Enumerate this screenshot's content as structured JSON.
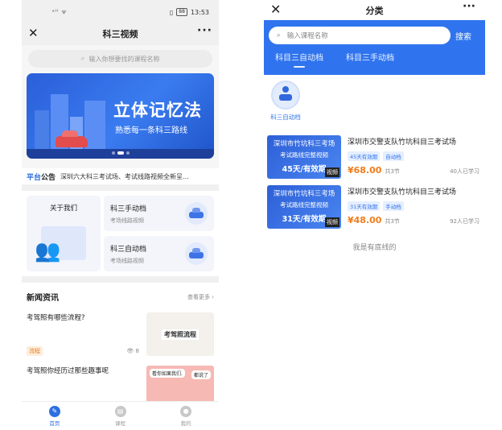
{
  "left": {
    "status": {
      "signal": "ᵃˡˡ ᯤ",
      "battery": "88",
      "time": "13:53"
    },
    "nav": {
      "close": "✕",
      "title": "科三视频",
      "more": "···"
    },
    "search": {
      "placeholder": "输入你想要找的课程名称"
    },
    "banner": {
      "headline": "立体记忆法",
      "subline": "熟悉每一条科三路线"
    },
    "notice": {
      "tag_a": "平台",
      "tag_b": "公告",
      "text": "深圳六大科三考试场、考试线路视频全新呈..."
    },
    "about": {
      "label": "关于我们"
    },
    "cards": [
      {
        "title": "科三手动档",
        "sub": "考场线路视频"
      },
      {
        "title": "科三自动档",
        "sub": "考场线路视频"
      }
    ],
    "news": {
      "heading": "新闻资讯",
      "more": "查看更多 ›",
      "items": [
        {
          "title": "考驾照有哪些流程?",
          "badge": "流程",
          "views": "8",
          "thumb_caption": "考驾照流程"
        },
        {
          "title": "考驾照你经历过那些趣事呢",
          "bubble1": "看你如果我们.",
          "bubble2": "都说了"
        }
      ]
    },
    "tabs": [
      {
        "label": "首页",
        "icon": "✎",
        "active": true
      },
      {
        "label": "课程",
        "icon": "▤",
        "active": false
      },
      {
        "label": "我的",
        "icon": "●",
        "active": false
      }
    ]
  },
  "right": {
    "nav": {
      "close": "✕",
      "title": "分类",
      "more": "···"
    },
    "search": {
      "placeholder": "输入课程名称",
      "button": "搜索"
    },
    "tabs": [
      {
        "label": "科目三自动档",
        "active": true
      },
      {
        "label": "科目三手动档",
        "active": false
      }
    ],
    "category": {
      "label": "科三自动档"
    },
    "courses": [
      {
        "thumb_line1": "深圳市竹坑科三考场",
        "thumb_line2": "考试路线完整视频",
        "thumb_line3": "45天/有效期",
        "video_tag": "视频",
        "title": "深圳市交警支队竹坑科目三考试场",
        "tag1": "45天有效期",
        "tag2": "自动档",
        "price": "¥68.00",
        "lessons": "共3节",
        "students": "40人已学习"
      },
      {
        "thumb_line1": "深圳市竹坑科三考场",
        "thumb_line2": "考试路线完整视频",
        "thumb_line3": "31天/有效期",
        "video_tag": "视频",
        "title": "深圳市交警支队竹坑科目三考试场",
        "tag1": "31天有效期",
        "tag2": "手动档",
        "price": "¥48.00",
        "lessons": "共3节",
        "students": "92人已学习"
      }
    ],
    "end_text": "我是有底线的"
  },
  "colors": {
    "accent": "#2f74ee",
    "price": "#f07c1a"
  }
}
